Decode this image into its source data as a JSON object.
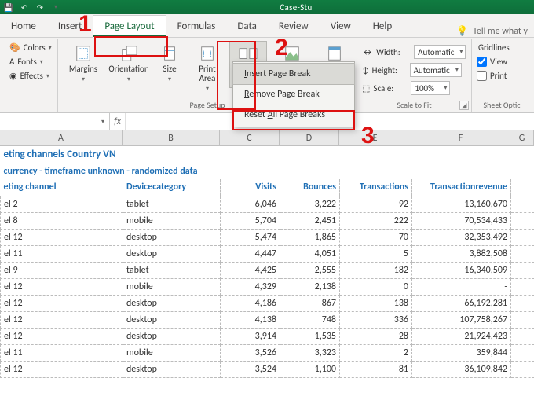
{
  "title": "Case-Stu",
  "tabs": [
    "Home",
    "Insert",
    "Page Layout",
    "Formulas",
    "Data",
    "Review",
    "View",
    "Help"
  ],
  "active_tab": "Page Layout",
  "tellme": "Tell me what y",
  "themes": {
    "colors": "Colors",
    "fonts": "Fonts",
    "effects": "Effects"
  },
  "page_setup": {
    "margins": "Margins",
    "orientation": "Orientation",
    "size": "Size",
    "printarea": "Print\nArea",
    "breaks": "Breaks",
    "background": "Background",
    "printtitles": "Print\nTitles",
    "group": "Page Setup"
  },
  "scale": {
    "width_l": "Width:",
    "width_v": "Automatic",
    "height_l": "Height:",
    "height_v": "Automatic",
    "scale_l": "Scale:",
    "scale_v": "100%",
    "group": "Scale to Fit"
  },
  "sheet_opt": {
    "gridlines": "Gridlines",
    "view": "View",
    "print": "Print",
    "group": "Sheet Optic"
  },
  "dropdown": {
    "insert": "Insert Page Break",
    "remove": "Remove Page Break",
    "reset": "Reset All Page Breaks"
  },
  "annotations": {
    "n1": "1",
    "n2": "2",
    "n3": "3"
  },
  "cols": [
    "A",
    "B",
    "C",
    "D",
    "E",
    "F",
    "G"
  ],
  "title_row1": "eting channels Country VN",
  "title_row2": "currency - timeframe unknown - randomized data",
  "headers": [
    "eting channel",
    "Devicecategory",
    "Visits",
    "Bounces",
    "Transactions",
    "Transactionrevenue"
  ],
  "rows": [
    {
      "c": "el 2",
      "d": "tablet",
      "v": "6,046",
      "b": "3,222",
      "t": "92",
      "r": "13,160,670"
    },
    {
      "c": "el 8",
      "d": "mobile",
      "v": "5,704",
      "b": "2,451",
      "t": "222",
      "r": "70,534,433"
    },
    {
      "c": "el 12",
      "d": "desktop",
      "v": "5,474",
      "b": "1,865",
      "t": "70",
      "r": "32,353,492"
    },
    {
      "c": "el 11",
      "d": "desktop",
      "v": "4,447",
      "b": "4,051",
      "t": "5",
      "r": "3,882,508"
    },
    {
      "c": "el 9",
      "d": "tablet",
      "v": "4,425",
      "b": "2,555",
      "t": "182",
      "r": "16,340,509"
    },
    {
      "c": "el 12",
      "d": "mobile",
      "v": "4,329",
      "b": "2,138",
      "t": "0",
      "r": "-"
    },
    {
      "c": "el 12",
      "d": "desktop",
      "v": "4,186",
      "b": "867",
      "t": "138",
      "r": "66,192,281"
    },
    {
      "c": "el 12",
      "d": "desktop",
      "v": "4,138",
      "b": "748",
      "t": "336",
      "r": "107,758,267"
    },
    {
      "c": "el 12",
      "d": "desktop",
      "v": "3,914",
      "b": "1,535",
      "t": "28",
      "r": "21,924,423"
    },
    {
      "c": "el 11",
      "d": "mobile",
      "v": "3,526",
      "b": "3,323",
      "t": "2",
      "r": "359,844"
    },
    {
      "c": "el 12",
      "d": "desktop",
      "v": "3,524",
      "b": "1,100",
      "t": "81",
      "r": "36,109,842"
    }
  ],
  "chart_data": {
    "type": "table",
    "title": "eting channels Country VN",
    "subtitle": "currency - timeframe unknown - randomized data",
    "columns": [
      "Marketing channel",
      "Devicecategory",
      "Visits",
      "Bounces",
      "Transactions",
      "Transactionrevenue"
    ],
    "data": [
      [
        "el 2",
        "tablet",
        6046,
        3222,
        92,
        13160670
      ],
      [
        "el 8",
        "mobile",
        5704,
        2451,
        222,
        70534433
      ],
      [
        "el 12",
        "desktop",
        5474,
        1865,
        70,
        32353492
      ],
      [
        "el 11",
        "desktop",
        4447,
        4051,
        5,
        3882508
      ],
      [
        "el 9",
        "tablet",
        4425,
        2555,
        182,
        16340509
      ],
      [
        "el 12",
        "mobile",
        4329,
        2138,
        0,
        null
      ],
      [
        "el 12",
        "desktop",
        4186,
        867,
        138,
        66192281
      ],
      [
        "el 12",
        "desktop",
        4138,
        748,
        336,
        107758267
      ],
      [
        "el 12",
        "desktop",
        3914,
        1535,
        28,
        21924423
      ],
      [
        "el 11",
        "mobile",
        3526,
        3323,
        2,
        359844
      ],
      [
        "el 12",
        "desktop",
        3524,
        1100,
        81,
        36109842
      ]
    ]
  }
}
